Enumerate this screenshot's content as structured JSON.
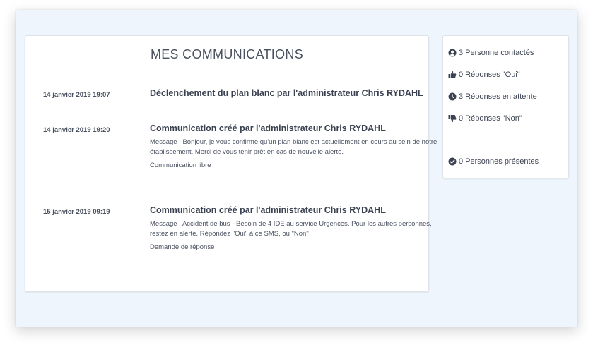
{
  "main": {
    "title": "MES COMMUNICATIONS",
    "communications": [
      {
        "date": "14 janvier 2019 19:07",
        "title": "Déclenchement du plan blanc par l'administrateur Chris RYDAHL"
      },
      {
        "date": "14 janvier 2019 19:20",
        "title": "Communication créé par l'administrateur Chris RYDAHL",
        "message": "Message : Bonjour, je vous confirme qu'un plan blanc est actuellement en cours au sein de notre établissement. Merci de vous tenir prêt en cas de nouvelle alerte.",
        "type": "Communication libre"
      },
      {
        "date": "15 janvier 2019 09:19",
        "title": "Communication créé par l'administrateur Chris RYDAHL",
        "message": "Message : Accident de bus - Besoin de 4 IDE au service Urgences. Pour les autres personnes, restez en alerte. Répondez \"Oui\" à ce SMS, ou \"Non\"",
        "type": "Demande de réponse"
      }
    ]
  },
  "stats": {
    "contacted": {
      "label": "3 Personne contactés",
      "icon": "user-circle-icon"
    },
    "yes": {
      "label": "0 Réponses \"Oui\"",
      "icon": "thumbs-up-icon"
    },
    "pending": {
      "label": "3 Réponses en attente",
      "icon": "clock-icon"
    },
    "no": {
      "label": "0 Réponses \"Non\"",
      "icon": "thumbs-down-icon"
    },
    "present": {
      "label": "0 Personnes présentes",
      "icon": "check-circle-icon"
    }
  },
  "colors": {
    "background": "#eef5fd",
    "text": "#3a4150",
    "card": "#ffffff"
  }
}
